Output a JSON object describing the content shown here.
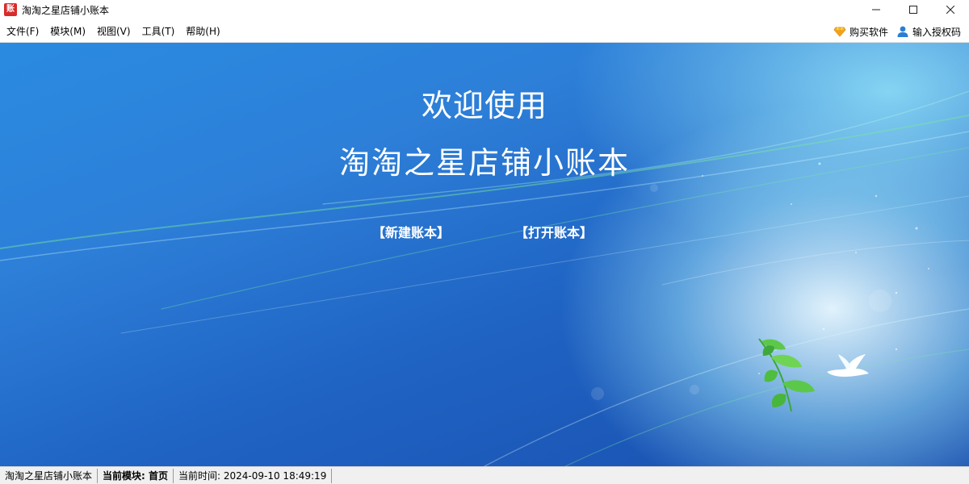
{
  "window": {
    "icon_label": "账",
    "title": "淘淘之星店铺小账本"
  },
  "menubar": {
    "items": [
      "文件(F)",
      "模块(M)",
      "视图(V)",
      "工具(T)",
      "帮助(H)"
    ],
    "buy_label": "购买软件",
    "license_label": "输入授权码"
  },
  "main": {
    "welcome": "欢迎使用",
    "title": "淘淘之星店铺小账本",
    "new_book": "【新建账本】",
    "open_book": "【打开账本】"
  },
  "statusbar": {
    "app_name": "淘淘之星店铺小账本",
    "module_label": "当前模块: ",
    "module_value": "首页",
    "time_label": "当前时间: ",
    "time_value": "2024-09-10 18:49:19"
  },
  "colors": {
    "accent_blue": "#2d7fd8",
    "icon_red": "#d92b2b",
    "leaf_green": "#5cc84a"
  },
  "icons": [
    "app-icon",
    "minimize-icon",
    "maximize-icon",
    "close-icon",
    "diamond-icon",
    "user-icon",
    "dove-icon",
    "leaf-branch-icon"
  ]
}
